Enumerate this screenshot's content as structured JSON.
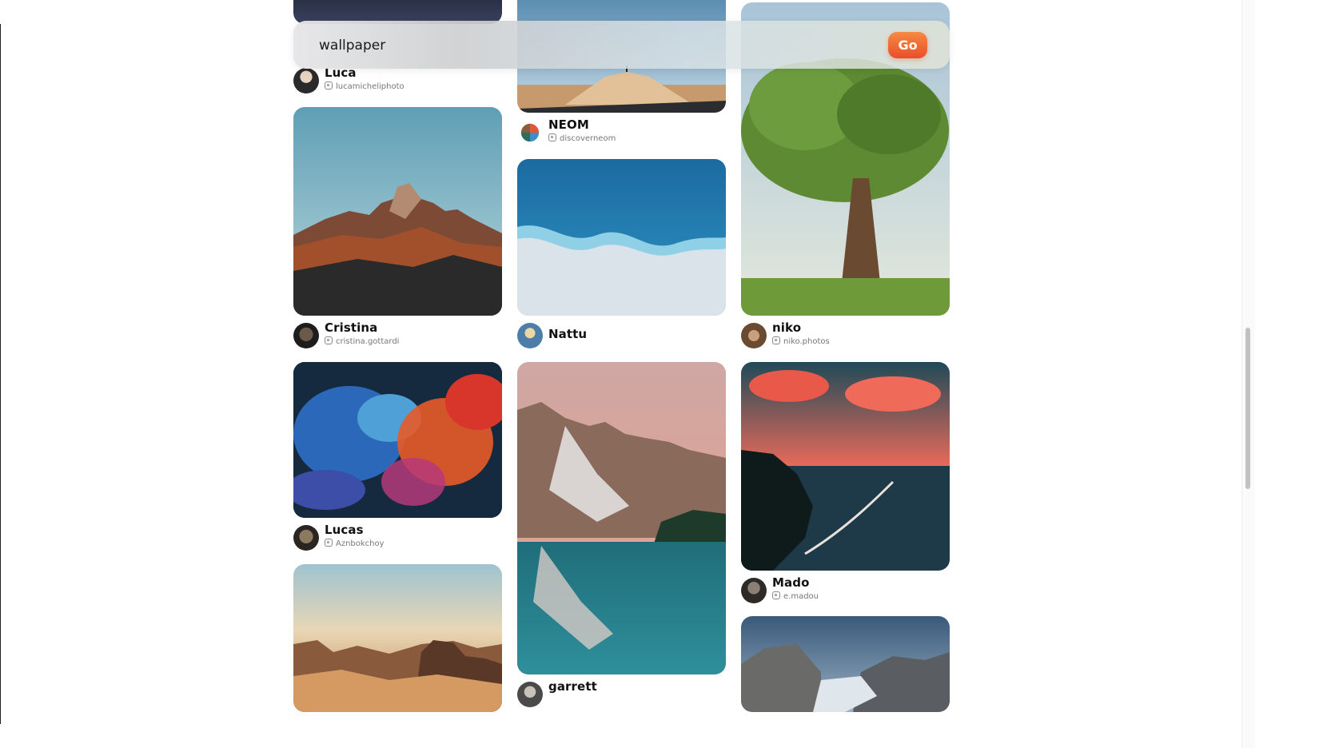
{
  "search": {
    "value": "wallpaper",
    "placeholder": "Search",
    "button_label": "Go"
  },
  "colors": {
    "accent": "#EE5A2F",
    "page_background": "#FFFFFF"
  },
  "gallery": {
    "column_1": [
      {
        "name": "Luca",
        "handle": "lucamicheliphoto",
        "image": "night-sky-photo"
      },
      {
        "name": "Cristina",
        "handle": "cristina.gottardi",
        "image": "mountain-peak-sunset-photo"
      },
      {
        "name": "Lucas",
        "handle": "Aznbokchoy",
        "image": "ink-in-water-photo"
      },
      {
        "name": "",
        "handle": "",
        "image": "desert-rocks-photo"
      }
    ],
    "column_2": [
      {
        "name": "NEOM",
        "handle": "discoverneom",
        "image": "desert-dune-photo"
      },
      {
        "name": "Nattu",
        "handle": "",
        "image": "ocean-waves-aerial-photo"
      },
      {
        "name": "garrett",
        "handle": "",
        "image": "mountain-lake-reflection-photo"
      }
    ],
    "column_3": [
      {
        "name": "niko",
        "handle": "niko.photos",
        "image": "big-tree-photo"
      },
      {
        "name": "Mado",
        "handle": "e.madou",
        "image": "sunset-lake-boat-photo"
      },
      {
        "name": "",
        "handle": "",
        "image": "yosemite-valley-photo"
      }
    ]
  }
}
